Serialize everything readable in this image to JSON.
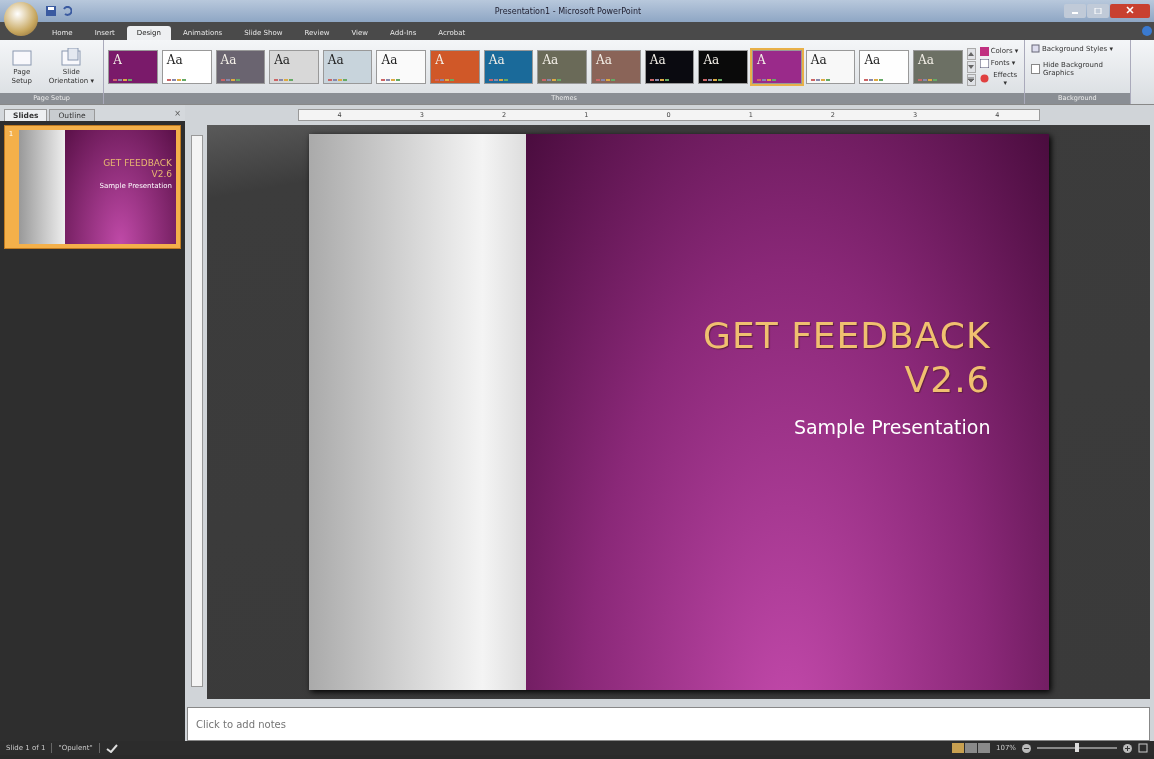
{
  "window": {
    "title": "Presentation1 - Microsoft PowerPoint"
  },
  "tabs": [
    {
      "label": "Home",
      "selected": false
    },
    {
      "label": "Insert",
      "selected": false
    },
    {
      "label": "Design",
      "selected": true
    },
    {
      "label": "Animations",
      "selected": false
    },
    {
      "label": "Slide Show",
      "selected": false
    },
    {
      "label": "Review",
      "selected": false
    },
    {
      "label": "View",
      "selected": false
    },
    {
      "label": "Add-Ins",
      "selected": false
    },
    {
      "label": "Acrobat",
      "selected": false
    }
  ],
  "page_setup": {
    "buttons": [
      "Page Setup",
      "Slide Orientation ▾"
    ],
    "group_label": "Page Setup"
  },
  "themes": {
    "group_label": "Themes",
    "items": [
      {
        "label": "A",
        "color": "#7a1a6a",
        "selected": false
      },
      {
        "label": "Aa",
        "color": "#ffffff",
        "selected": false
      },
      {
        "label": "Aa",
        "color": "#6a6470",
        "selected": false
      },
      {
        "label": "Aa",
        "color": "#d8d8d8",
        "selected": false
      },
      {
        "label": "Aa",
        "color": "#c8d4dc",
        "selected": false
      },
      {
        "label": "Aa",
        "color": "#fafafa",
        "selected": false
      },
      {
        "label": "A",
        "color": "#d05828",
        "selected": false
      },
      {
        "label": "Aa",
        "color": "#1a6a9a",
        "selected": false
      },
      {
        "label": "Aa",
        "color": "#6a6a58",
        "selected": false
      },
      {
        "label": "Aa",
        "color": "#8a6458",
        "selected": false
      },
      {
        "label": "Aa",
        "color": "#0a0a10",
        "selected": false
      },
      {
        "label": "Aa",
        "color": "#0a0a0a",
        "selected": false
      },
      {
        "label": "A",
        "color": "#9a2a8a",
        "selected": true
      },
      {
        "label": "Aa",
        "color": "#f8f8f8",
        "selected": false
      },
      {
        "label": "Aa",
        "color": "#fefefe",
        "selected": false
      },
      {
        "label": "Aa",
        "color": "#6c7064",
        "selected": false
      }
    ],
    "options": [
      "Colors ▾",
      "Fonts ▾",
      "Effects ▾"
    ]
  },
  "background": {
    "styles_label": "Background Styles ▾",
    "hide_graphics": {
      "label": "Hide Background Graphics",
      "checked": false
    },
    "group_label": "Background"
  },
  "pane": {
    "tabs": [
      {
        "label": "Slides",
        "selected": true
      },
      {
        "label": "Outline",
        "selected": false
      }
    ],
    "close": "×",
    "thumbnails": [
      {
        "number": "1",
        "title": "GET FEEDBACK",
        "subtitle_line": "V2.6",
        "text": "Sample Presentation",
        "selected": true
      }
    ]
  },
  "ruler": {
    "labels": [
      "4",
      "3",
      "2",
      "1",
      "0",
      "1",
      "2",
      "3",
      "4"
    ]
  },
  "slide": {
    "title": "GET FEEDBACK",
    "title_line_2": "V2.6",
    "subtitle": "Sample Presentation"
  },
  "notes": {
    "placeholder": "Click to add notes"
  },
  "status_bar": {
    "slide_info": "Slide 1 of 1",
    "theme": "\"Opulent\"",
    "zoom": "107%",
    "zoom_slider": {
      "level": 0.5
    }
  }
}
